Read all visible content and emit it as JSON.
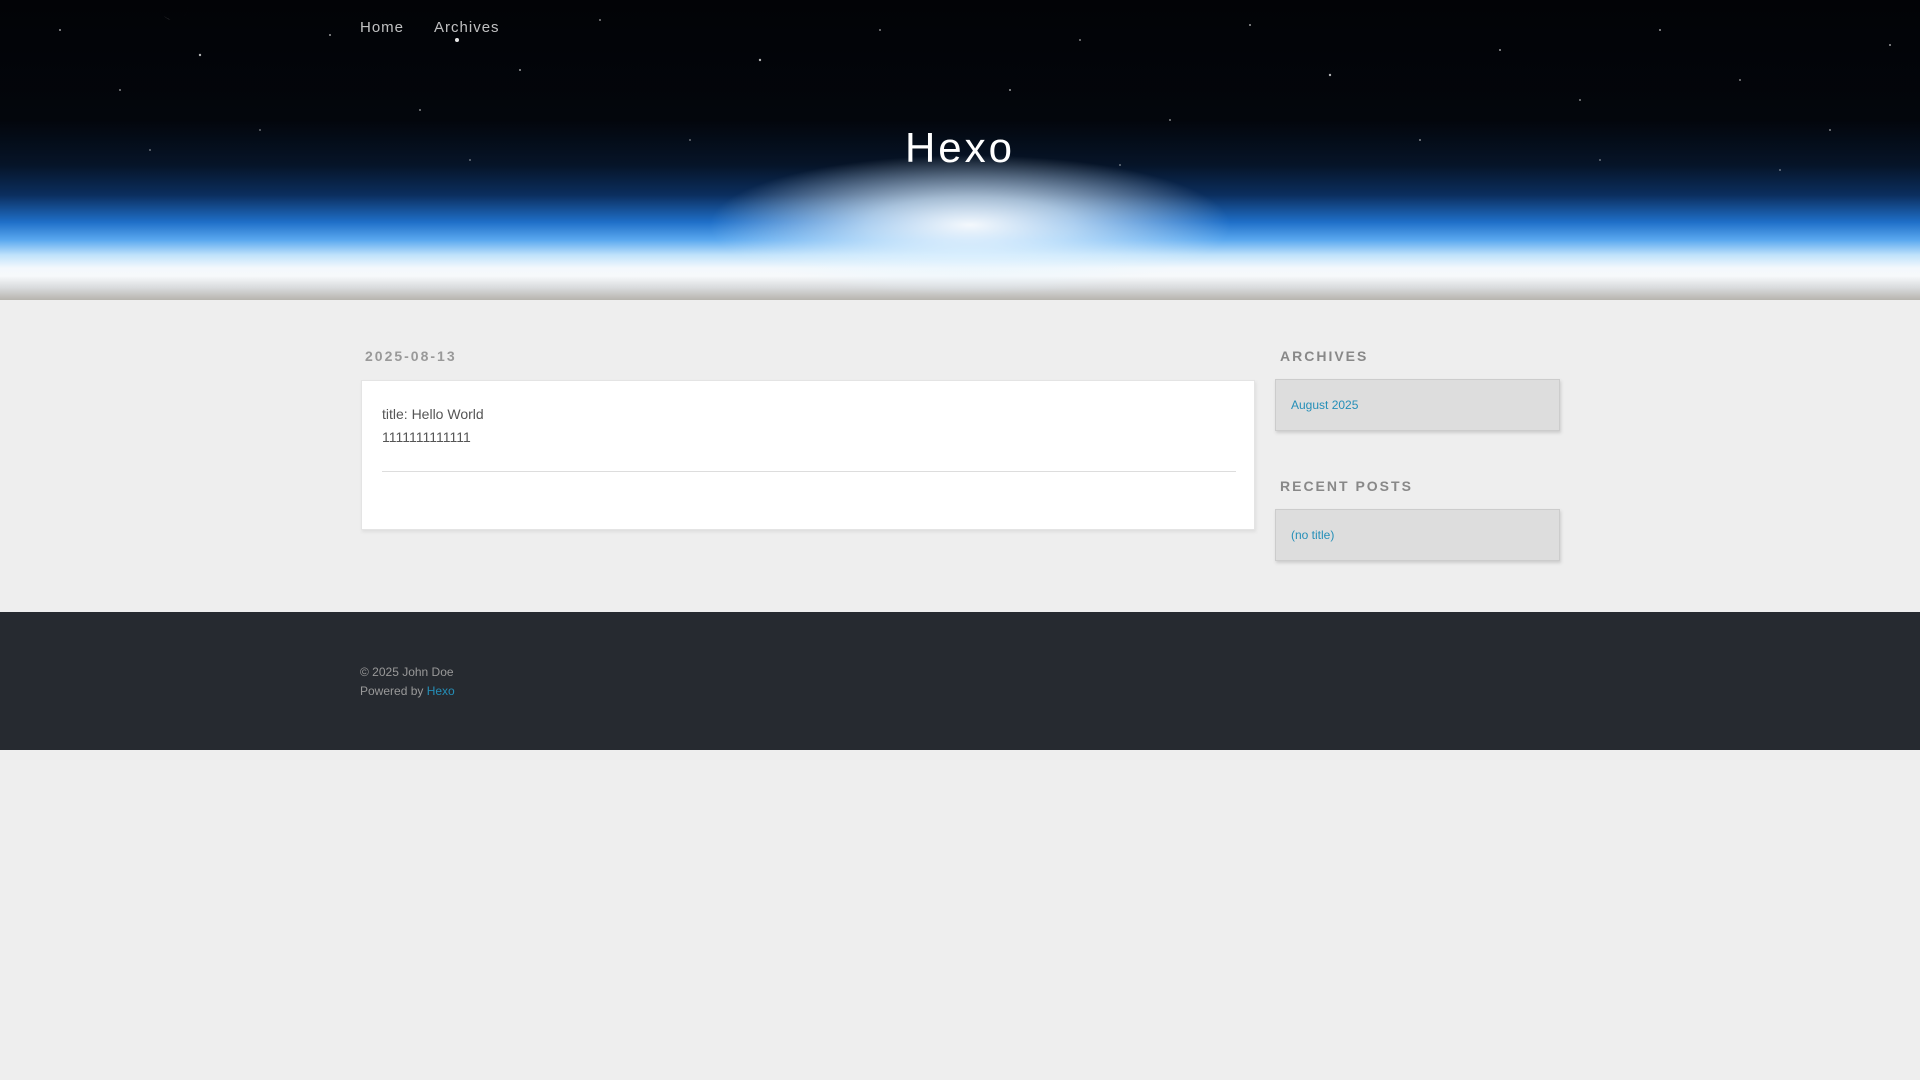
{
  "nav": {
    "home": "Home",
    "archives": "Archives"
  },
  "site": {
    "title": "Hexo"
  },
  "article": {
    "date": "2025-08-13",
    "line1": "title: Hello World",
    "line2": "1111111111111"
  },
  "sidebar": {
    "archives_title": "Archives",
    "archives_items": [
      "August 2025"
    ],
    "recent_title": "Recent Posts",
    "recent_items": [
      "(no title)"
    ]
  },
  "footer": {
    "copyright": "© 2025 John Doe",
    "powered_by": "Powered by",
    "powered_link": "Hexo"
  },
  "colors": {
    "link": "#258fb8",
    "footer_bg": "#262a30",
    "page_bg": "#eeeeee"
  }
}
